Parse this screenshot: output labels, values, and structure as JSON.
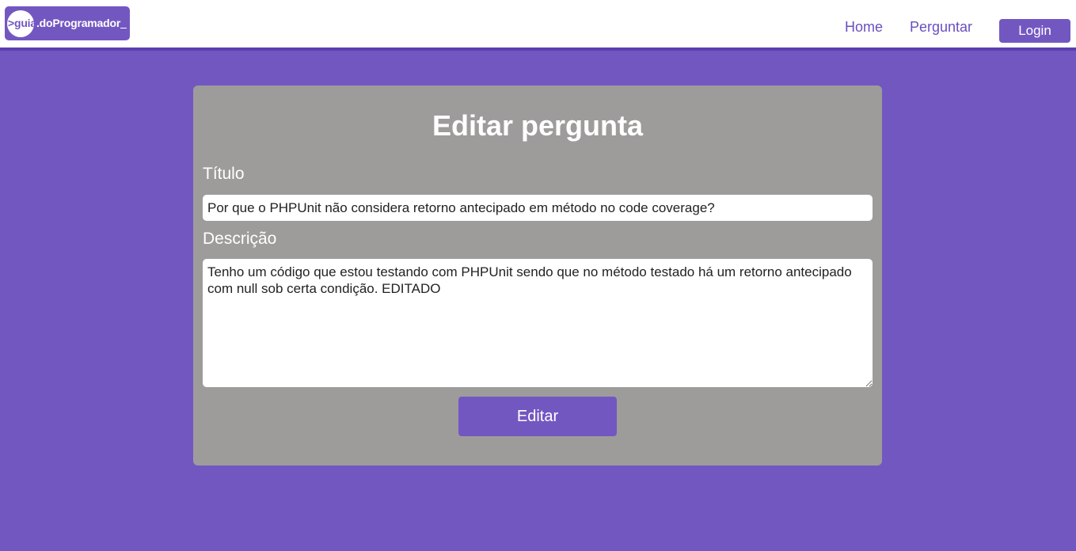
{
  "header": {
    "logo": {
      "part1": ">guia",
      "part2": ".doProgramador",
      "cursor": "_"
    },
    "nav": {
      "home": "Home",
      "ask": "Perguntar",
      "login": "Login"
    }
  },
  "form": {
    "title": "Editar pergunta",
    "title_label": "Título",
    "title_value": "Por que o PHPUnit não considera retorno antecipado em método no code coverage?",
    "description_label": "Descrição",
    "description_value": "Tenho um código que estou testando com PHPUnit sendo que no método testado há um retorno antecipado com null sob certa condição. EDITADO",
    "submit_label": "Editar"
  },
  "colors": {
    "brand": "#7357c1",
    "card": "#9d9c9b",
    "header_bg": "#ffffff"
  }
}
